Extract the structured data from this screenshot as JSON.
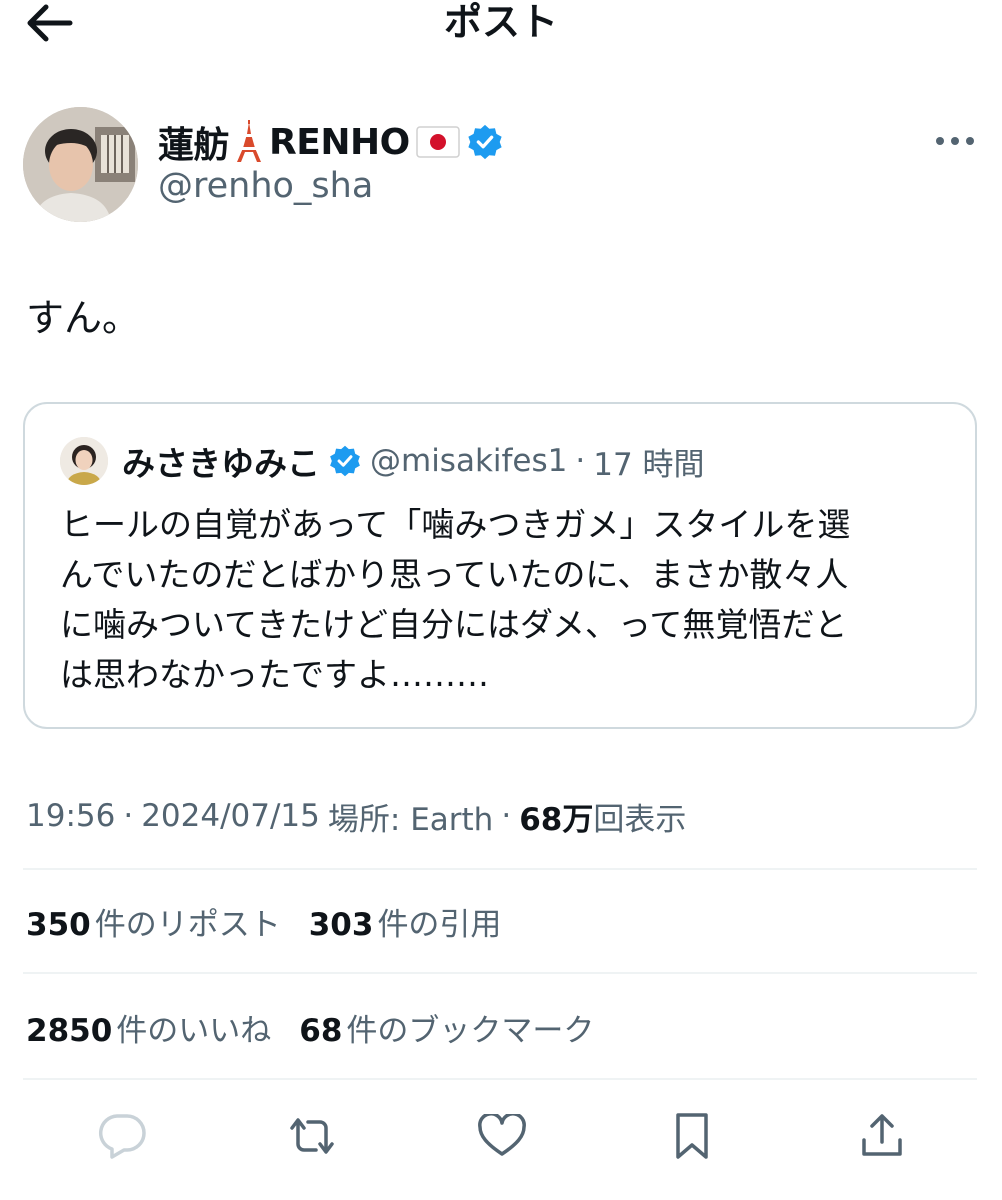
{
  "header": {
    "back_icon": "arrow-left-icon",
    "title": "ポスト"
  },
  "post": {
    "author": {
      "display_name": "蓮舫🗼RENHO🇯🇵",
      "name_text": "蓮舫",
      "name_suffix": "RENHO",
      "handle": "@renho_sha",
      "verified": true
    },
    "more_icon": "more-dots-icon",
    "text": "すん。",
    "quote": {
      "author_name": "みさきゆみこ",
      "verified": true,
      "handle": "@misakifes1",
      "separator": "·",
      "time": "17 時間",
      "text_lines": [
        "ヒールの自覚があって「噛みつきガメ」スタイルを選",
        "んでいたのだとばかり思っていたのに、まさか散々人",
        "に噛みついてきたけど自分にはダメ、って無覚悟だと",
        "は思わなかったですよ………"
      ]
    },
    "meta": {
      "time": "19:56",
      "sep1": "·",
      "date": "2024/07/15",
      "location": "場所: Earth",
      "sep2": "·",
      "views_num": "68万",
      "views_label": "回表示"
    },
    "stats": {
      "reposts_num": "350",
      "reposts_label": "件のリポスト",
      "quotes_num": "303",
      "quotes_label": "件の引用",
      "likes_num": "2850",
      "likes_label": "件のいいね",
      "bookmarks_num": "68",
      "bookmarks_label": "件のブックマーク"
    },
    "actions": [
      "reply-icon",
      "repost-icon",
      "like-icon",
      "bookmark-icon",
      "share-icon"
    ]
  },
  "colors": {
    "text": "#0f1419",
    "secondary": "#536471",
    "verified": "#1d9bf0",
    "border": "#cfd9de",
    "divider": "#eff3f4"
  }
}
